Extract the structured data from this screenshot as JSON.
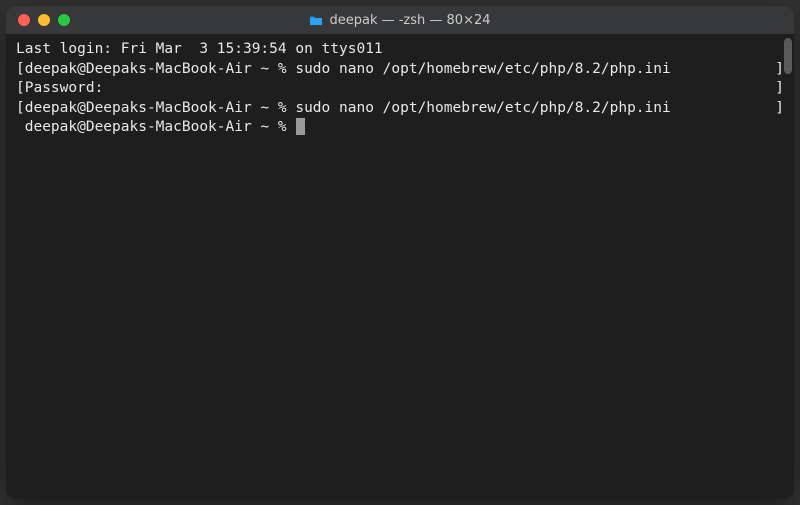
{
  "window": {
    "title": "deepak — -zsh — 80×24"
  },
  "terminal": {
    "lines": [
      {
        "left": "Last login: Fri Mar  3 15:39:54 on ttys011",
        "right": ""
      },
      {
        "left": "[deepak@Deepaks-MacBook-Air ~ % sudo nano /opt/homebrew/etc/php/8.2/php.ini",
        "right": "]"
      },
      {
        "left": "[Password:",
        "right": "]"
      },
      {
        "left": "[deepak@Deepaks-MacBook-Air ~ % sudo nano /opt/homebrew/etc/php/8.2/php.ini",
        "right": "]"
      },
      {
        "left": " deepak@Deepaks-MacBook-Air ~ % ",
        "right": "",
        "cursor": true
      }
    ]
  }
}
